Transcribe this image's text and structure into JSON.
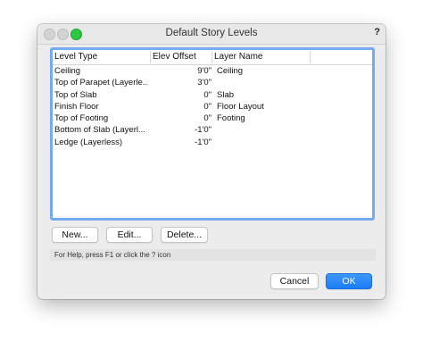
{
  "window": {
    "title": "Default Story Levels",
    "help_icon_glyph": "?"
  },
  "table": {
    "columns": [
      "Level Type",
      "Elev Offset",
      "Layer Name"
    ],
    "rows": [
      {
        "level_type": "Ceiling",
        "elev_offset": "9'0\"",
        "layer_name": "Ceiling"
      },
      {
        "level_type": "Top of Parapet (Layerle...",
        "elev_offset": "3'0\"",
        "layer_name": ""
      },
      {
        "level_type": "Top of Slab",
        "elev_offset": "0\"",
        "layer_name": "Slab"
      },
      {
        "level_type": "Finish Floor",
        "elev_offset": "0\"",
        "layer_name": "Floor Layout"
      },
      {
        "level_type": "Top of Footing",
        "elev_offset": "0\"",
        "layer_name": "Footing"
      },
      {
        "level_type": "Bottom of Slab (Layerl...",
        "elev_offset": "-1'0\"",
        "layer_name": ""
      },
      {
        "level_type": "Ledge (Layerless)",
        "elev_offset": "-1'0\"",
        "layer_name": ""
      }
    ]
  },
  "actions": {
    "new_label": "New...",
    "edit_label": "Edit...",
    "delete_label": "Delete..."
  },
  "help_text": "For Help, press F1 or click the ? icon",
  "footer": {
    "cancel_label": "Cancel",
    "ok_label": "OK"
  },
  "colors": {
    "focus_ring": "#74aaf0",
    "primary_button": "#1a7cf4",
    "zoom_button": "#2bc93f"
  }
}
